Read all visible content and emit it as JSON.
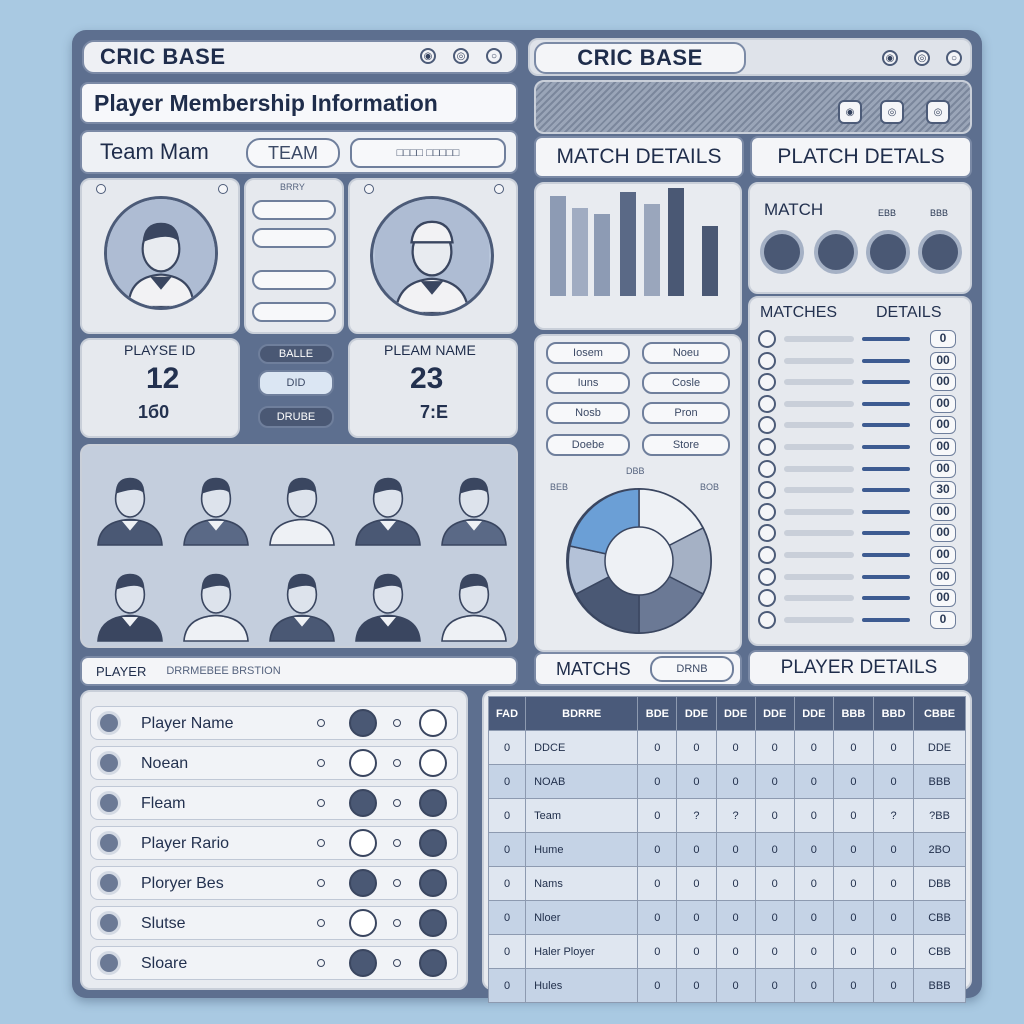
{
  "left_header": {
    "title": "CRIC BASE",
    "icons": [
      "info-icon",
      "search-icon",
      "record-icon"
    ]
  },
  "right_header": {
    "title": "CRIC BASE",
    "icons": [
      "info-icon",
      "minimize-icon",
      "close-icon"
    ]
  },
  "banner_title": "Player Membership Information",
  "team_bar": {
    "label": "Team Mam",
    "button": "TEAM",
    "field": "□□□□ □□□□□"
  },
  "player_card_left": {
    "id_label": "PLAYSE ID",
    "number": "12",
    "sub": "1б0"
  },
  "player_card_right": {
    "id_label": "PLEAM NAME",
    "number": "23",
    "sub": "7:E"
  },
  "mid_menu_header": "BRRY",
  "mid_buttons": [
    "BALLE",
    "DID",
    "DRUBE"
  ],
  "match_details_tab": "MATCH DETAILS",
  "platch_details_tab": "PLATCH DETALS",
  "match_panel": {
    "title": "MATCH",
    "col1": "EBB",
    "col2": "BBB",
    "matches_label": "MATCHES",
    "details_label": "DETAILS",
    "row_values": [
      "0",
      "00",
      "00",
      "00",
      "00",
      "00",
      "00",
      "30",
      "00",
      "00",
      "00",
      "00",
      "00",
      "0"
    ]
  },
  "bar_chart_buttons": [
    "Iosem",
    "Noeu",
    "Iuns",
    "Cosle",
    "Nosb",
    "Pron",
    "Doebe",
    "Store"
  ],
  "pie_labels": {
    "top": "DBB",
    "left": "BEB",
    "right": "BOB"
  },
  "bottom_left_tabs": {
    "player_bar": "PLAYER",
    "player_sub": "DRRMEBEE BRSTION"
  },
  "matchs_bar": {
    "label": "MATCHS",
    "button": "DRNB"
  },
  "player_details_tab": "PLAYER DETAILS",
  "player_list": [
    {
      "label": "Player Name"
    },
    {
      "label": "Noean"
    },
    {
      "label": "Fleam"
    },
    {
      "label": "Player Rario"
    },
    {
      "label": "Ploryer Bes"
    },
    {
      "label": "Slutse"
    },
    {
      "label": "Sloare"
    }
  ],
  "stats_table": {
    "headers": [
      "FAD",
      "BDRRE",
      "BDE",
      "DDE",
      "DDE",
      "DDE",
      "DDE",
      "BBB",
      "BBD",
      "CBBE"
    ],
    "rows": [
      [
        "0",
        "DDCE",
        "0",
        "0",
        "0",
        "0",
        "0",
        "0",
        "0",
        "DDE"
      ],
      [
        "0",
        "NOAB",
        "0",
        "0",
        "0",
        "0",
        "0",
        "0",
        "0",
        "BBB"
      ],
      [
        "0",
        "Team",
        "0",
        "?",
        "?",
        "0",
        "0",
        "0",
        "?",
        "?BB"
      ],
      [
        "0",
        "Hume",
        "0",
        "0",
        "0",
        "0",
        "0",
        "0",
        "0",
        "2BO"
      ],
      [
        "0",
        "Nams",
        "0",
        "0",
        "0",
        "0",
        "0",
        "0",
        "0",
        "DBB"
      ],
      [
        "0",
        "Nloer",
        "0",
        "0",
        "0",
        "0",
        "0",
        "0",
        "0",
        "CBB"
      ],
      [
        "0",
        "Haler Ployer",
        "0",
        "0",
        "0",
        "0",
        "0",
        "0",
        "0",
        "CBB"
      ],
      [
        "0",
        "Hules",
        "0",
        "0",
        "0",
        "0",
        "0",
        "0",
        "0",
        "BBB"
      ]
    ]
  },
  "colors": {
    "frame": "#5d6f8f",
    "accent": "#4a5a7a",
    "pie_light": "#6b9fd6",
    "pie_dark": "#4a5874",
    "background": "#a9c9e2"
  }
}
